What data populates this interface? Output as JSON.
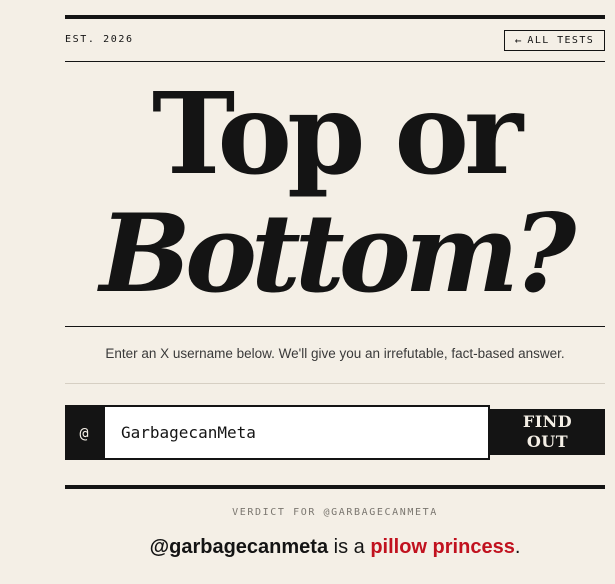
{
  "header": {
    "est_label": "EST. 2026",
    "all_tests_arrow": "←",
    "all_tests_label": "ALL TESTS"
  },
  "hero": {
    "title_line1": "Top or",
    "title_line2": "Bottom?"
  },
  "subtitle": "Enter an X username below. We'll give you an irrefutable, fact-based answer.",
  "form": {
    "at_symbol": "@",
    "username_value": "GarbagecanMeta",
    "submit_line1": "FIND",
    "submit_line2": "OUT"
  },
  "result": {
    "verdict_label": "VERDICT FOR @GARBAGECANMETA",
    "handle": "@garbagecanmeta",
    "connector": " is a ",
    "verdict": "pillow princess",
    "punctuation": "."
  },
  "colors": {
    "background": "#f4efe6",
    "ink": "#141414",
    "accent": "#c1121f"
  },
  "icons": {
    "back": "left-arrow-icon"
  }
}
